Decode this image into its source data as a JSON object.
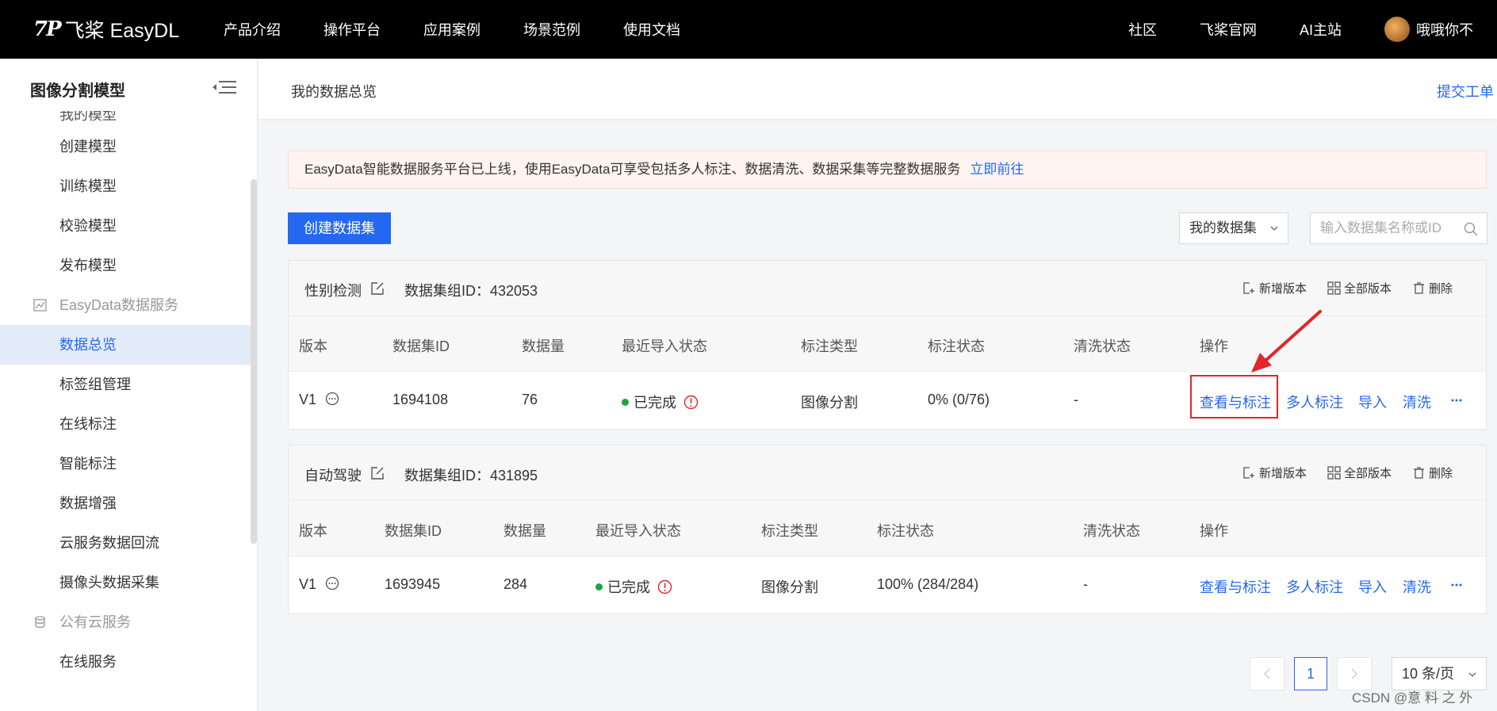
{
  "topnav": {
    "logo_mark": "7P",
    "logo_text": "飞桨 EasyDL",
    "links": [
      "产品介绍",
      "操作平台",
      "应用案例",
      "场景范例",
      "使用文档"
    ],
    "right_links": [
      "社区",
      "飞桨官网",
      "AI主站"
    ],
    "username": "哦哦你不"
  },
  "sidebar": {
    "title": "图像分割模型",
    "partial_item": "我的模型",
    "items_model": [
      "创建模型",
      "训练模型",
      "校验模型",
      "发布模型"
    ],
    "group_data": "EasyData数据服务",
    "items_data": [
      "数据总览",
      "标签组管理",
      "在线标注",
      "智能标注",
      "数据增强",
      "云服务数据回流",
      "摄像头数据采集"
    ],
    "active_item": "数据总览",
    "group_cloud": "公有云服务",
    "items_cloud": [
      "在线服务"
    ]
  },
  "breadcrumb": {
    "title": "我的数据总览",
    "ticket": "提交工单"
  },
  "notice": {
    "text": "EasyData智能数据服务平台已上线，使用EasyData可享受包括多人标注、数据清洗、数据采集等完整数据服务",
    "link": "立即前往"
  },
  "toolbar": {
    "create_label": "创建数据集",
    "filter_value": "我的数据集",
    "search_placeholder": "输入数据集名称或ID"
  },
  "dataset_actions": {
    "add_version": "新增版本",
    "all_versions": "全部版本",
    "delete": "删除"
  },
  "table_headers": [
    "版本",
    "数据集ID",
    "数据量",
    "最近导入状态",
    "标注类型",
    "标注状态",
    "清洗状态",
    "操作"
  ],
  "operations": [
    "查看与标注",
    "多人标注",
    "导入",
    "清洗"
  ],
  "datasets": [
    {
      "name": "性别检测",
      "group_id": "数据集组ID：432053",
      "row": {
        "version": "V1",
        "dataset_id": "1694108",
        "count": "76",
        "import_status": "已完成",
        "label_type": "图像分割",
        "label_status": "0% (0/76)",
        "clean_status": "-"
      }
    },
    {
      "name": "自动驾驶",
      "group_id": "数据集组ID：431895",
      "row": {
        "version": "V1",
        "dataset_id": "1693945",
        "count": "284",
        "import_status": "已完成",
        "label_type": "图像分割",
        "label_status": "100% (284/284)",
        "clean_status": "-"
      }
    }
  ],
  "pagination": {
    "current_page": "1",
    "page_size": "10 条/页"
  },
  "watermark": "CSDN @意 料 之 外",
  "colors": {
    "accent": "#2468f2",
    "highlight": "#e3252a",
    "success": "#1fa346",
    "warning": "#e3252a"
  }
}
